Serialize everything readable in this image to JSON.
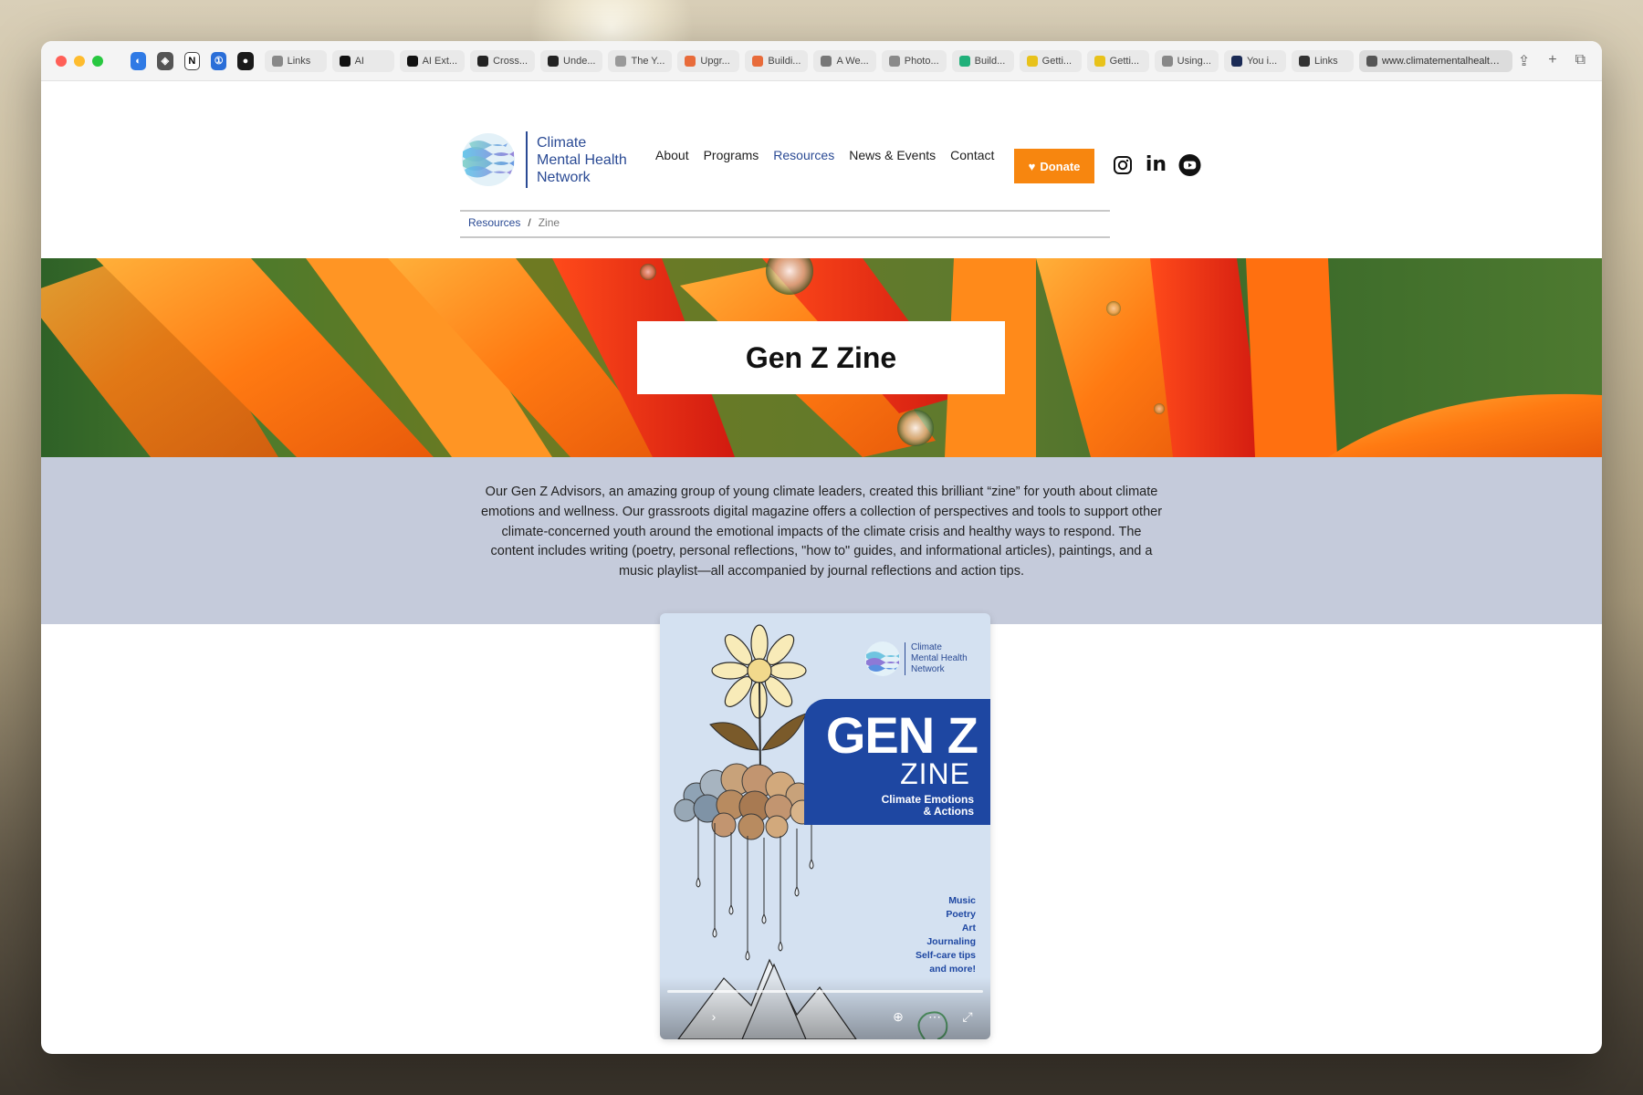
{
  "browser": {
    "tabs": [
      {
        "label": "Links",
        "color": "#888888"
      },
      {
        "label": "AI",
        "color": "#111111"
      },
      {
        "label": "AI Ext...",
        "color": "#111111"
      },
      {
        "label": "Cross...",
        "color": "#222222"
      },
      {
        "label": "Unde...",
        "color": "#222222"
      },
      {
        "label": "The Y...",
        "color": "#999999"
      },
      {
        "label": "Upgr...",
        "color": "#e86b3a"
      },
      {
        "label": "Buildi...",
        "color": "#e86b3a"
      },
      {
        "label": "A We...",
        "color": "#777777"
      },
      {
        "label": "Photo...",
        "color": "#8a8a8a"
      },
      {
        "label": "Build...",
        "color": "#20b07a"
      },
      {
        "label": "Getti...",
        "color": "#e8c21a"
      },
      {
        "label": "Getti...",
        "color": "#e8c21a"
      },
      {
        "label": "Using...",
        "color": "#888888"
      },
      {
        "label": "You i...",
        "color": "#1a2a55"
      },
      {
        "label": "Links",
        "color": "#333333"
      }
    ],
    "active_tab_url": "www.climatementalhealth.net"
  },
  "site": {
    "logo": {
      "line1": "Climate",
      "line2": "Mental Health",
      "line3": "Network"
    },
    "nav": [
      "About",
      "Programs",
      "Resources",
      "News & Events",
      "Contact"
    ],
    "nav_active": "Resources",
    "donate_label": "Donate",
    "accent_color": "#f7860f",
    "brand_color": "#2a4a94"
  },
  "breadcrumb": {
    "parent": "Resources",
    "separator": "/",
    "current": "Zine"
  },
  "hero": {
    "title": "Gen Z Zine"
  },
  "intro": {
    "text": "Our Gen Z Advisors, an amazing group of young climate leaders, created this brilliant “zine” for youth about climate emotions and wellness. Our grassroots digital magazine offers a collection of perspectives and tools to support other climate-concerned youth around the emotional impacts of the climate crisis and healthy ways to respond. The content includes writing (poetry, personal reflections, \"how to\" guides, and informational articles), paintings, and a music playlist—all accompanied by journal reflections and action tips."
  },
  "zine": {
    "logo_line1": "Climate",
    "logo_line2": "Mental Health",
    "logo_line3": "Network",
    "title_big": "GEN Z",
    "title_mid": "ZINE",
    "subtitle_line1": "Climate Emotions",
    "subtitle_line2": "& Actions",
    "contents": [
      "Music",
      "Poetry",
      "Art",
      "Journaling",
      "Self-care tips",
      "and more!"
    ]
  }
}
